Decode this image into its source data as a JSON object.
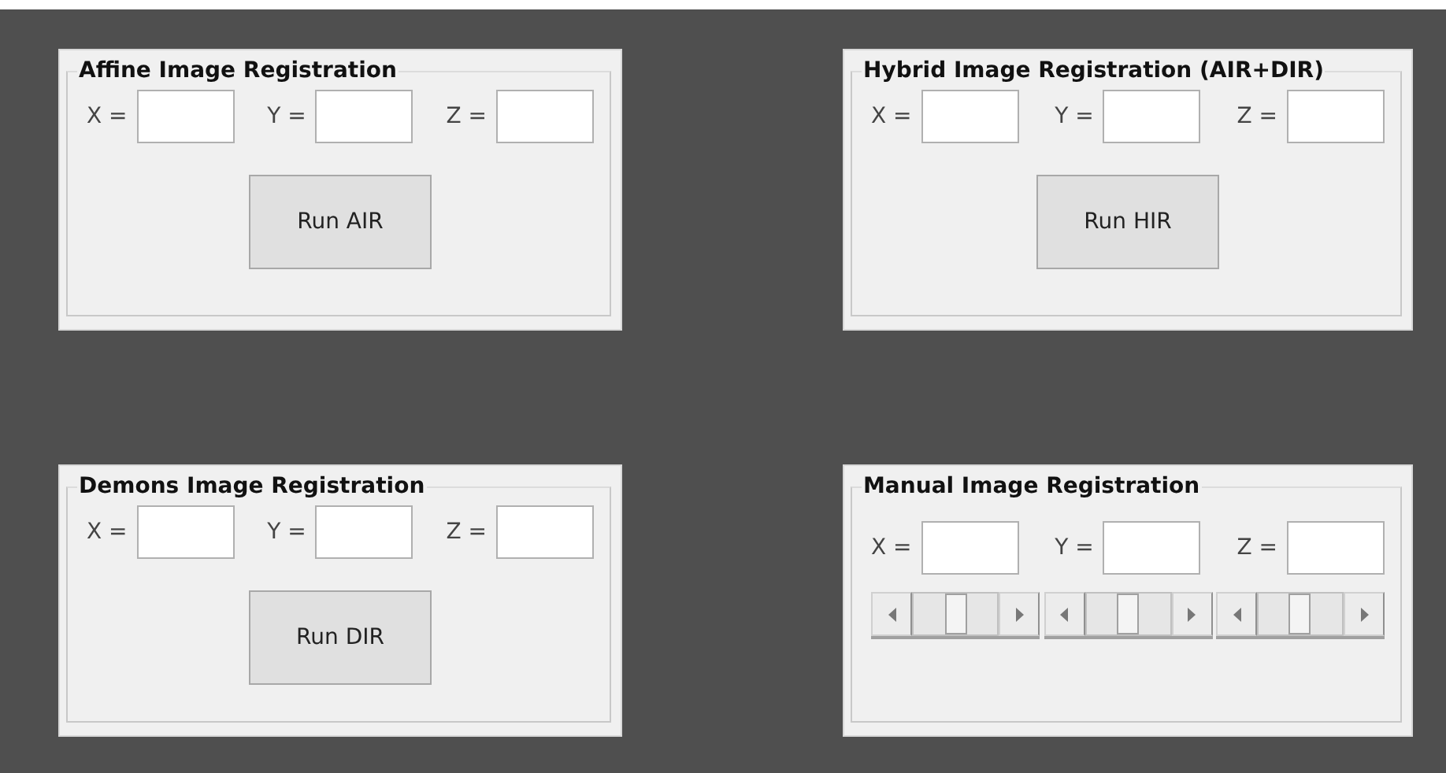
{
  "panels": [
    {
      "title": "Affine Image Registration",
      "fields": [
        {
          "label": "X ="
        },
        {
          "label": "Y ="
        },
        {
          "label": "Z ="
        }
      ],
      "button": "Run AIR"
    },
    {
      "title": "Hybrid Image Registration (AIR+DIR)",
      "fields": [
        {
          "label": "X ="
        },
        {
          "label": "Y ="
        },
        {
          "label": "Z ="
        }
      ],
      "button": "Run HIR"
    },
    {
      "title": "Demons Image Registration",
      "fields": [
        {
          "label": "X ="
        },
        {
          "label": "Y ="
        },
        {
          "label": "Z ="
        }
      ],
      "button": "Run DIR"
    },
    {
      "title": "Manual Image Registration",
      "fields": [
        {
          "label": "X ="
        },
        {
          "label": "Y ="
        },
        {
          "label": "Z ="
        }
      ],
      "sliders": [
        {
          "level": 0.5
        },
        {
          "level": 0.51
        },
        {
          "level": 0.49
        }
      ]
    }
  ]
}
